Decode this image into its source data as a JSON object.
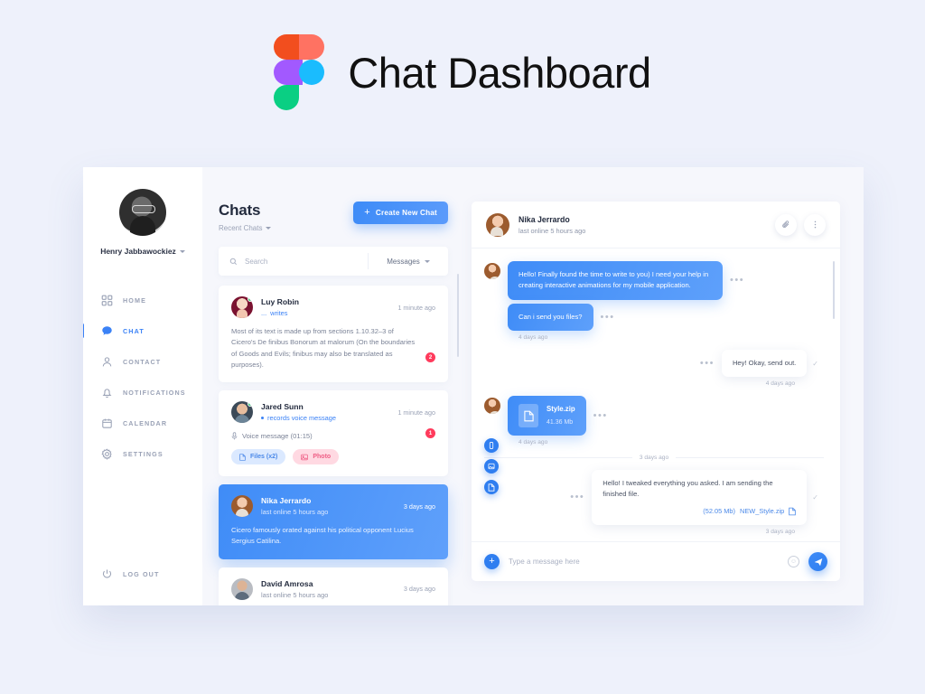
{
  "header": {
    "title": "Chat Dashboard",
    "logo_icon": "figma-logo"
  },
  "sidebar": {
    "profile": {
      "name": "Henry Jabbawockiez",
      "avatar_icon": "user-avatar",
      "caret_icon": "chevron-down-icon"
    },
    "items": [
      {
        "label": "HOME",
        "icon": "grid-icon",
        "active": false
      },
      {
        "label": "CHAT",
        "icon": "chat-bubble-icon",
        "active": true
      },
      {
        "label": "CONTACT",
        "icon": "person-icon",
        "active": false
      },
      {
        "label": "NOTIFICATIONS",
        "icon": "bell-icon",
        "active": false
      },
      {
        "label": "CALENDAR",
        "icon": "calendar-icon",
        "active": false
      },
      {
        "label": "SETTINGS",
        "icon": "gear-icon",
        "active": false
      }
    ],
    "logout": {
      "label": "LOG OUT",
      "icon": "power-icon"
    }
  },
  "list": {
    "title": "Chats",
    "filter_label": "Recent Chats",
    "new_chat_label": "Create New Chat",
    "search_placeholder": "Search",
    "search_icon": "search-icon",
    "messages_filter": "Messages",
    "items": [
      {
        "name": "Luy Robin",
        "status": "writes",
        "status_prefix": "...",
        "time": "1 minute ago",
        "preview": "Most of its text is made up from sections 1.10.32–3 of Cicero's De finibus Bonorum at malorum (On the boundaries of Goods and Evils; finibus may also be translated as purposes).",
        "badge": "2",
        "selected": false,
        "avatar_icon": "avatar-luy-robin"
      },
      {
        "name": "Jared Sunn",
        "status": "records voice message",
        "time": "1 minute ago",
        "voice_message": "Voice message (01:15)",
        "tags": [
          {
            "label": "Files (x2)",
            "icon": "file-icon",
            "kind": "files"
          },
          {
            "label": "Photo",
            "icon": "image-icon",
            "kind": "photo"
          }
        ],
        "badge": "1",
        "selected": false,
        "avatar_icon": "avatar-jared-sunn"
      },
      {
        "name": "Nika Jerrardo",
        "status": "last online 5 hours ago",
        "time": "3 days ago",
        "preview": "Cicero famously orated against his political opponent Lucius Sergius Catilina.",
        "selected": true,
        "avatar_icon": "avatar-nika-jerrardo"
      },
      {
        "name": "David Amrosa",
        "status": "last online 5 hours ago",
        "time": "3 days ago",
        "selected": false,
        "avatar_icon": "avatar-david-amrosa"
      }
    ]
  },
  "conversation": {
    "contact_name": "Nika Jerrardo",
    "contact_status": "last online 5 hours ago",
    "attach_icon": "paperclip-icon",
    "more_icon": "more-vertical-icon",
    "day_separator": "3 days ago",
    "messages": [
      {
        "dir": "in",
        "text": "Hello! Finally found the time to write to you) I need your help in creating interactive animations for my mobile application.",
        "time": ""
      },
      {
        "dir": "in",
        "text": "Can i send you files?",
        "time": "4 days ago"
      },
      {
        "dir": "out",
        "text": "Hey! Okay, send out.",
        "time": "4 days ago"
      },
      {
        "dir": "in",
        "type": "file",
        "file_name": "Style.zip",
        "file_size": "41.36 Mb",
        "time": "4 days ago"
      },
      {
        "dir": "out",
        "text": "Hello! I tweaked everything you asked. I am sending the finished file.",
        "attachment_size": "(52.05 Mb)",
        "attachment_name": "NEW_Style.zip",
        "time": "3 days ago"
      }
    ],
    "quick_actions": [
      {
        "icon": "phone-icon"
      },
      {
        "icon": "image-icon"
      },
      {
        "icon": "file-icon"
      }
    ],
    "composer": {
      "add_icon": "plus-icon",
      "placeholder": "Type a message here",
      "emoji_icon": "smiley-icon",
      "send_icon": "send-icon"
    }
  },
  "colors": {
    "accent": "#3b82f6",
    "page_bg": "#eef1fb",
    "badge": "#ff3b5c",
    "photo_tag": "#ef5e85",
    "online": "#2ecc71"
  }
}
